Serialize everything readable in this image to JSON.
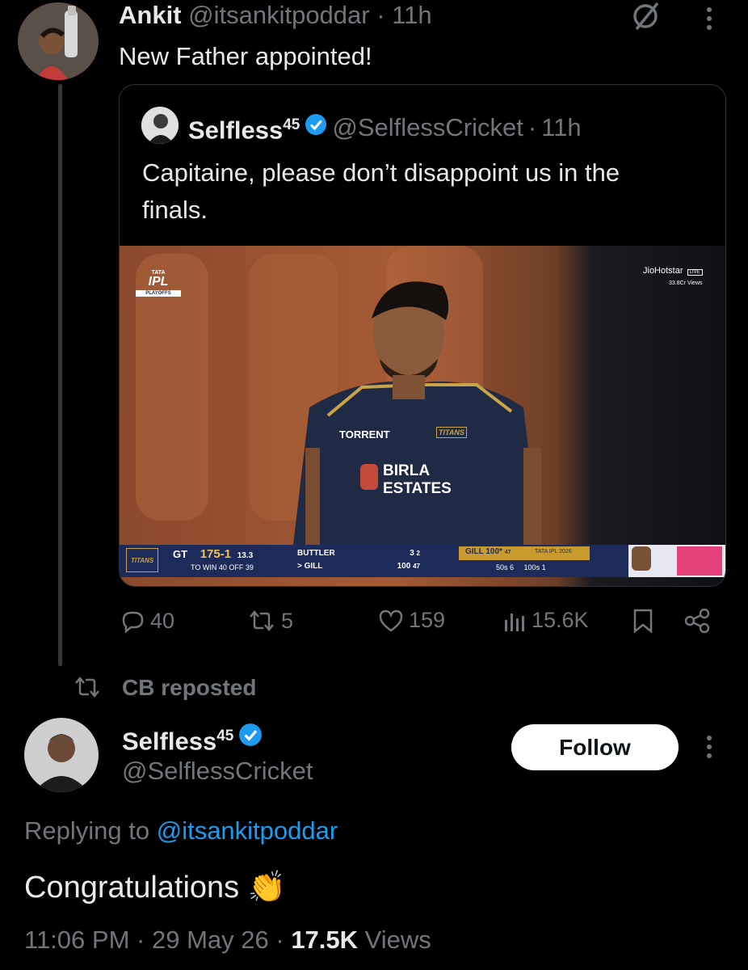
{
  "parent_tweet": {
    "name": "Ankit",
    "handle": "@itsankitpoddar",
    "sep": "·",
    "time": "11h",
    "text": "New Father appointed!"
  },
  "quoted_tweet": {
    "name": "Selfless",
    "name_sup": "45",
    "handle": "@SelflessCricket",
    "sep": "·",
    "time": "11h",
    "text": "Capitaine, please don’t disappoint us in the finals."
  },
  "media": {
    "broadcaster": "JioHotstar",
    "live": "LIVE",
    "views": "33.8Cr Views",
    "tournament_logo_top": "TATA",
    "tournament_logo": "IPL",
    "tournament_logo_sub": "PLAYOFFS",
    "jersey_sponsor": "TORRENT",
    "jersey_team": "TITANS",
    "jersey_main": "BIRLA",
    "jersey_main2": "ESTATES",
    "scorebar": {
      "team_logo": "TITANS",
      "team": "GT",
      "score": "175-1",
      "overs": "13.3",
      "target": "TO WIN 40 OFF 39",
      "bat1": "BUTTLER",
      "bat2": "> GILL",
      "bat1_score": "3",
      "bat1_balls": "2",
      "bat2_score": "100",
      "bat2_balls": "47",
      "player_tag": "GILL 100*",
      "player_balls": "47",
      "event": "TATA IPL 2026",
      "stats": "50s 6",
      "stats2": "100s 1"
    }
  },
  "actions": {
    "replies": "40",
    "reposts": "5",
    "likes": "159",
    "views": "15.6K"
  },
  "repost_header": "CB reposted",
  "main_tweet": {
    "name": "Selfless",
    "name_sup": "45",
    "handle": "@SelflessCricket",
    "follow_label": "Follow",
    "replying_prefix": "Replying to",
    "replying_handle": "@itsankitpoddar",
    "text": "Congratulations",
    "emoji": "👏",
    "time": "11:06 PM",
    "sep1": "·",
    "date": "29 May 26",
    "sep2": "·",
    "views_count": "17.5K",
    "views_label": "Views"
  },
  "colors": {
    "background": "#000000",
    "text": "#e7e9ea",
    "muted": "#71767b",
    "accent": "#1d9bf0",
    "verified": "#1d9bf0"
  }
}
